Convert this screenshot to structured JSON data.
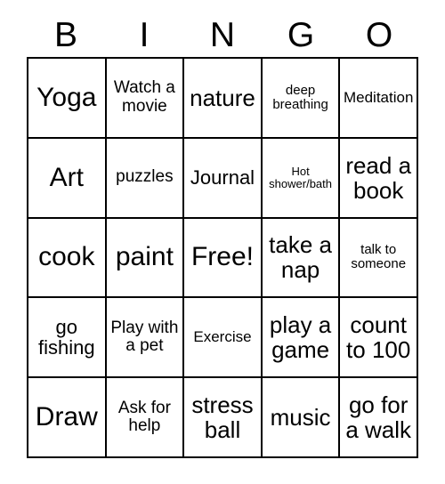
{
  "card": {
    "title": "BINGO Card",
    "header_letters": [
      "B",
      "I",
      "N",
      "G",
      "O"
    ],
    "columns": 5,
    "rows": 5,
    "border_color": "#000000",
    "background_color": "#ffffff",
    "text_color": "#000000",
    "cells": [
      {
        "text": "Yoga",
        "size": "fs-xxl"
      },
      {
        "text": "Watch a movie",
        "size": "fs-md"
      },
      {
        "text": "nature",
        "size": "fs-xl"
      },
      {
        "text": "deep breathing",
        "size": "fs-xs"
      },
      {
        "text": "Meditation",
        "size": "fs-sm"
      },
      {
        "text": "Art",
        "size": "fs-xxl"
      },
      {
        "text": "puzzles",
        "size": "fs-md"
      },
      {
        "text": "Journal",
        "size": "fs-lg"
      },
      {
        "text": "Hot shower/bath",
        "size": "fs-xxs"
      },
      {
        "text": "read a book",
        "size": "fs-xl"
      },
      {
        "text": "cook",
        "size": "fs-xxl"
      },
      {
        "text": "paint",
        "size": "fs-xxl"
      },
      {
        "text": "Free!",
        "size": "fs-xxl"
      },
      {
        "text": "take a nap",
        "size": "fs-xl"
      },
      {
        "text": "talk to someone",
        "size": "fs-xs"
      },
      {
        "text": "go fishing",
        "size": "fs-lg"
      },
      {
        "text": "Play with a pet",
        "size": "fs-md"
      },
      {
        "text": "Exercise",
        "size": "fs-sm"
      },
      {
        "text": "play a game",
        "size": "fs-xl"
      },
      {
        "text": "count to 100",
        "size": "fs-xl"
      },
      {
        "text": "Draw",
        "size": "fs-xxl"
      },
      {
        "text": "Ask for help",
        "size": "fs-md"
      },
      {
        "text": "stress ball",
        "size": "fs-xl"
      },
      {
        "text": "music",
        "size": "fs-xl"
      },
      {
        "text": "go for a walk",
        "size": "fs-xl"
      }
    ]
  }
}
